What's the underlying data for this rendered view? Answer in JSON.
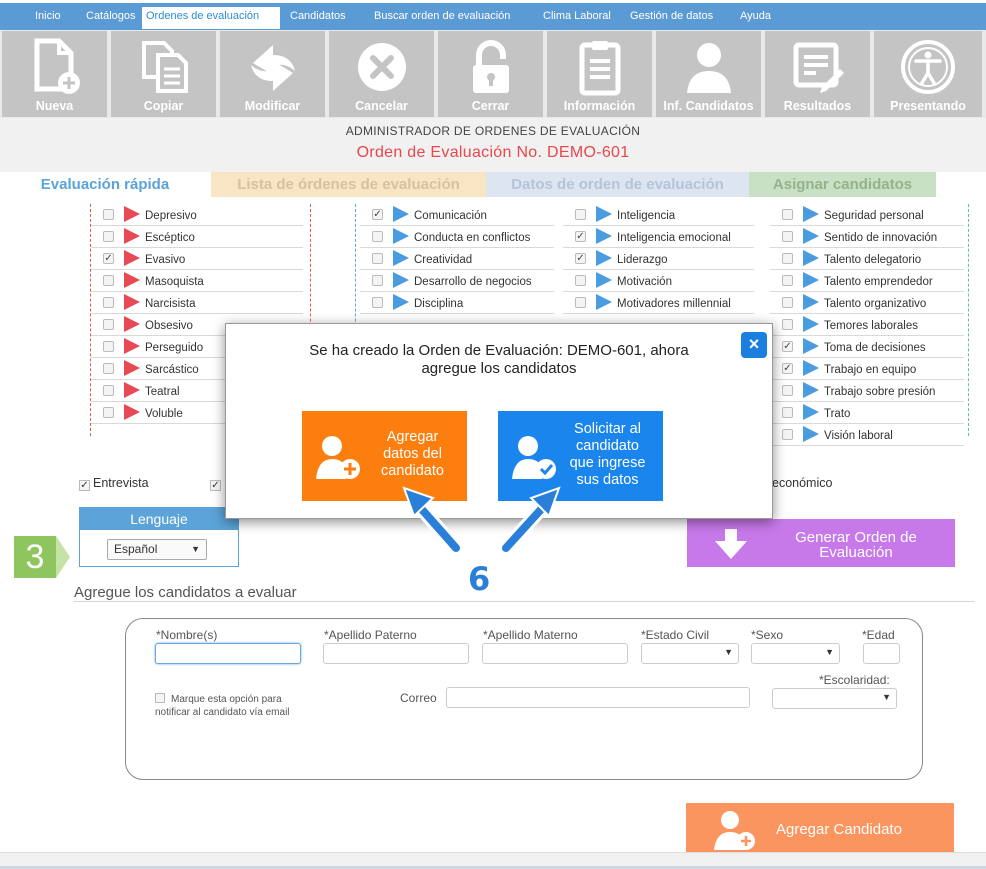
{
  "topnav": {
    "items": [
      "Inicio",
      "Catálogos",
      "Ordenes de evaluación",
      "Candidatos",
      "Buscar orden de evaluación",
      "Clima Laboral",
      "Gestión de datos",
      "Ayuda"
    ],
    "active": "Ordenes de evaluación"
  },
  "toolbar": {
    "buttons": [
      {
        "label": "Nueva",
        "icon": "new-document-icon"
      },
      {
        "label": "Copiar",
        "icon": "copy-icon"
      },
      {
        "label": "Modificar",
        "icon": "refresh-icon"
      },
      {
        "label": "Cancelar",
        "icon": "cancel-icon"
      },
      {
        "label": "Cerrar",
        "icon": "lock-icon"
      },
      {
        "label": "Información",
        "icon": "clipboard-icon"
      },
      {
        "label": "Inf. Candidatos",
        "icon": "candidate-icon"
      },
      {
        "label": "Resultados",
        "icon": "results-icon"
      },
      {
        "label": "Presentando",
        "icon": "accessibility-icon"
      }
    ]
  },
  "header": {
    "admin_title": "ADMINISTRADOR DE ORDENES DE EVALUACIÓN",
    "order_title": "Orden de Evaluación No. DEMO-601"
  },
  "tabs": [
    "Evaluación rápida",
    "Lista de órdenes de evaluación",
    "Datos de orden de evaluación",
    "Asignar candidatos"
  ],
  "checklist": {
    "col1": [
      {
        "label": "Depresivo",
        "checked": false
      },
      {
        "label": "Escéptico",
        "checked": false
      },
      {
        "label": "Evasivo",
        "checked": true
      },
      {
        "label": "Masoquista",
        "checked": false
      },
      {
        "label": "Narcisista",
        "checked": false
      },
      {
        "label": "Obsesivo",
        "checked": false
      },
      {
        "label": "Perseguido",
        "checked": false
      },
      {
        "label": "Sarcástico",
        "checked": false
      },
      {
        "label": "Teatral",
        "checked": false
      },
      {
        "label": "Voluble",
        "checked": false
      }
    ],
    "col2": [
      {
        "label": "Comunicación",
        "checked": true
      },
      {
        "label": "Conducta en conflictos",
        "checked": false
      },
      {
        "label": "Creatividad",
        "checked": false
      },
      {
        "label": "Desarrollo de negocios",
        "checked": false
      },
      {
        "label": "Disciplina",
        "checked": false
      }
    ],
    "col3": [
      {
        "label": "Inteligencia",
        "checked": false
      },
      {
        "label": "Inteligencia emocional",
        "checked": true
      },
      {
        "label": "Liderazgo",
        "checked": true
      },
      {
        "label": "Motivación",
        "checked": false
      },
      {
        "label": "Motivadores millennial",
        "checked": false
      }
    ],
    "col4": [
      {
        "label": "Seguridad personal",
        "checked": false
      },
      {
        "label": "Sentido de innovación",
        "checked": false
      },
      {
        "label": "Talento delegatorio",
        "checked": false
      },
      {
        "label": "Talento emprendedor",
        "checked": false
      },
      {
        "label": "Talento organizativo",
        "checked": false
      },
      {
        "label": "Temores laborales",
        "checked": false
      },
      {
        "label": "Toma de decisiones",
        "checked": true
      },
      {
        "label": "Trabajo en equipo",
        "checked": true
      },
      {
        "label": "Trabajo sobre presión",
        "checked": false
      },
      {
        "label": "Trato",
        "checked": false
      },
      {
        "label": "Visión laboral",
        "checked": false
      }
    ]
  },
  "options": {
    "entrevista": "Entrevista",
    "economico": "económico"
  },
  "step3": "3",
  "language": {
    "title": "Lenguaje",
    "selected": "Español"
  },
  "generate_button": "Generar Orden de Evaluación",
  "candidates_section": {
    "title": "Agregue los candidatos a evaluar",
    "fields": {
      "nombre": "*Nombre(s)",
      "paterno": "*Apellido Paterno",
      "materno": "*Apellido Materno",
      "estado_civil": "*Estado Civil",
      "sexo": "*Sexo",
      "edad": "*Edad",
      "correo": "Correo",
      "escolaridad": "*Escolaridad:"
    },
    "notify_line1": "Marque esta opción para",
    "notify_line2": "notificar al candidato vía email",
    "add_button": "Agregar Candidato"
  },
  "modal": {
    "message_line1": "Se ha creado la Orden de Evaluación: DEMO-601, ahora",
    "message_line2": "agregue los candidatos",
    "btn_add_line1": "Agregar",
    "btn_add_line2": "datos del",
    "btn_add_line3": "candidato",
    "btn_request_line1": "Solicitar al",
    "btn_request_line2": "candidato",
    "btn_request_line3": "que ingrese",
    "btn_request_line4": "sus datos",
    "close_label": "×"
  },
  "step6": "6",
  "colors": {
    "nav": "#5b9bd5",
    "orange": "#fb7e0e",
    "blue": "#1a86ed",
    "purple": "#c779ea",
    "red": "#e8474b"
  }
}
